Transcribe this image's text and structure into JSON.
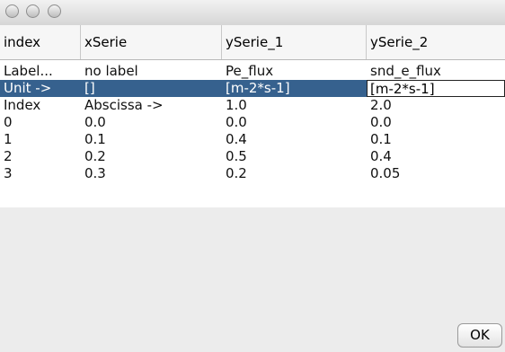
{
  "window": {
    "buttons": [
      "close-icon",
      "minimize-icon",
      "zoom-icon"
    ]
  },
  "table": {
    "columns": [
      "index",
      "xSerie",
      "ySerie_1",
      "ySerie_2"
    ],
    "rows": [
      [
        "Label...",
        "no label",
        "Pe_flux",
        "snd_e_flux"
      ],
      [
        "Unit ->",
        "[]",
        "[m-2*s-1]",
        ""
      ],
      [
        "Index",
        "Abscissa ->",
        "1.0",
        "2.0"
      ],
      [
        "0",
        "0.0",
        "0.0",
        "0.0"
      ],
      [
        "1",
        "0.1",
        "0.4",
        "0.1"
      ],
      [
        "2",
        "0.2",
        "0.5",
        "0.4"
      ],
      [
        "3",
        "0.3",
        "0.2",
        "0.05"
      ]
    ],
    "selected_row_index": 1,
    "editing_value": "[m-2*s-1]"
  },
  "footer": {
    "ok_label": "OK"
  }
}
